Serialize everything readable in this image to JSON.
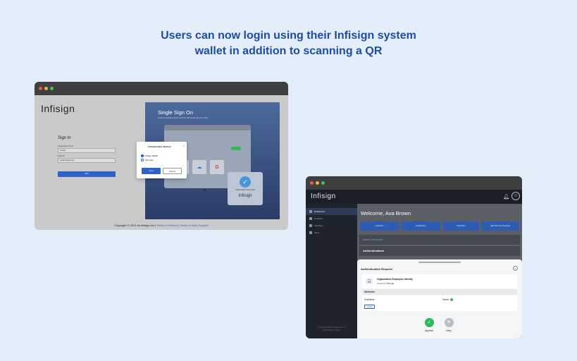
{
  "headline": {
    "line1": "Users can now login using their Infisign system",
    "line2": "wallet in addition to scanning a QR"
  },
  "colors": {
    "accent": "#2d62c8",
    "headline": "#1d4ca6",
    "success": "#2eb85c"
  },
  "login_window": {
    "logo": "Infisign",
    "signin": {
      "title": "Sign In",
      "org_label": "Organization Name",
      "org_value": "Infisign",
      "email_label": "Email ID",
      "email_value": "ava@infisign.com",
      "next_label": "Next"
    },
    "sso": {
      "title": "Single Sign On",
      "subtitle": "Unlock a seamless world of access with Single Sign-On magic.",
      "green_badge": "● SSO",
      "verified_caption": "Authentication Successful",
      "verified_logo": "Infisign",
      "verified_small": "Verified"
    },
    "auth_modal": {
      "title": "Authentication Method",
      "close": "×",
      "options": [
        "Infisign Wallet",
        "QR code"
      ],
      "next_label": "Next",
      "cancel_label": "Cancel"
    },
    "footer": {
      "copyright": "Copyright © 2024 by Infisign Inc",
      "tos": "Terms of Service",
      "tou": "Terms of use",
      "support": "Support",
      "sep": "|"
    }
  },
  "wallet_window": {
    "logo": "Infisign",
    "sidebar": {
      "items": [
        {
          "label": "Dashboard",
          "icon": "grid-icon"
        },
        {
          "label": "Contacts",
          "icon": "contacts-icon"
        },
        {
          "label": "Identities",
          "icon": "id-card-icon"
        },
        {
          "label": "Inbox",
          "icon": "inbox-icon"
        }
      ],
      "copyright": "© 2024 by Infisign. All rights reserved",
      "links": "Privacy Policy | Support"
    },
    "welcome_prefix": "Welcome,",
    "user_name": "Ava Brown",
    "quick_actions": [
      "Contacts",
      "Application",
      "Identities",
      "Self Service Request"
    ],
    "active_sessions": "Active Sessions",
    "authentications": "Authentications",
    "auth_request": {
      "title": "Authentication Request",
      "org": "Organization Employee Identity",
      "issued_prefix": "Issued by",
      "issuer": "Infisign",
      "attributes_label": "Attributes",
      "attr_key": "FirstName",
      "attr_value": "Saved",
      "more_label": "+ More",
      "approve": "Approve",
      "deny": "Deny"
    }
  }
}
